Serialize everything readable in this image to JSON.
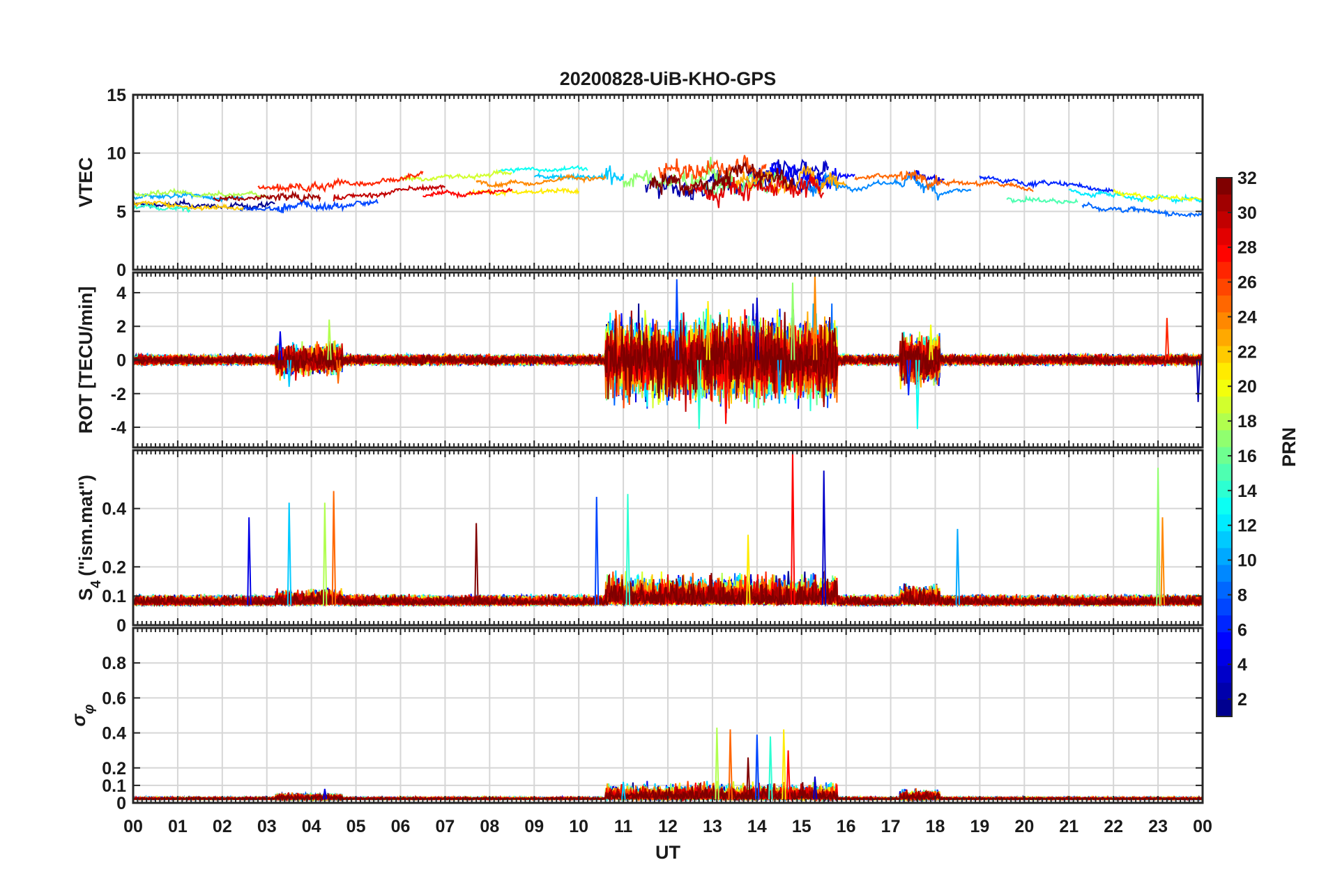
{
  "chart_data": {
    "type": "line",
    "title": "20200828-UiB-KHO-GPS",
    "xlabel": "UT",
    "x_range_hours": [
      0,
      24
    ],
    "x_tick_labels": [
      "00",
      "01",
      "02",
      "03",
      "04",
      "05",
      "06",
      "07",
      "08",
      "09",
      "10",
      "11",
      "12",
      "13",
      "14",
      "15",
      "16",
      "17",
      "18",
      "19",
      "20",
      "21",
      "22",
      "23",
      "00"
    ],
    "grid": true,
    "colorbar": {
      "label": "PRN",
      "range": [
        1,
        32
      ],
      "tick_labels": [
        "2",
        "4",
        "6",
        "8",
        "10",
        "12",
        "14",
        "16",
        "18",
        "20",
        "22",
        "24",
        "26",
        "28",
        "30",
        "32"
      ],
      "colormap": [
        "#00008f",
        "#0000ff",
        "#0080ff",
        "#00ffff",
        "#80ff80",
        "#ffff00",
        "#ff8000",
        "#ff0000",
        "#800000"
      ]
    },
    "panels": [
      {
        "name": "vtec",
        "ylabel": "VTEC",
        "ylim": [
          0,
          15
        ],
        "y_ticks": [
          0,
          5,
          10,
          15
        ],
        "y_tick_labels": [
          "0",
          "5",
          "10",
          "15"
        ],
        "baseline": [
          [
            0,
            6.2
          ],
          [
            2,
            6.0
          ],
          [
            4,
            6.3
          ],
          [
            6,
            7.2
          ],
          [
            8,
            7.6
          ],
          [
            10,
            7.9
          ],
          [
            11,
            7.6
          ],
          [
            12,
            7.3
          ],
          [
            13,
            7.8
          ],
          [
            14,
            8.2
          ],
          [
            15,
            7.8
          ],
          [
            16,
            7.4
          ],
          [
            17,
            7.8
          ],
          [
            18,
            7.4
          ],
          [
            19,
            7.0
          ],
          [
            20,
            6.6
          ],
          [
            21,
            6.2
          ],
          [
            22,
            5.8
          ],
          [
            23,
            5.4
          ],
          [
            24,
            5.3
          ]
        ],
        "noise": 0.35,
        "noise_active": 1.2,
        "series": [
          {
            "prn": 1,
            "start": 0,
            "end": 3.2
          },
          {
            "prn": 2,
            "start": 11.5,
            "end": 15.6
          },
          {
            "prn": 3,
            "start": 13.8,
            "end": 15.6
          },
          {
            "prn": 4,
            "start": 17.4,
            "end": 18.2
          },
          {
            "prn": 5,
            "start": 14.3,
            "end": 16.2
          },
          {
            "prn": 6,
            "start": 19.0,
            "end": 22.0
          },
          {
            "prn": 7,
            "start": 2.4,
            "end": 5.5
          },
          {
            "prn": 8,
            "start": 21.3,
            "end": 24
          },
          {
            "prn": 9,
            "start": 15.0,
            "end": 18.8
          },
          {
            "prn": 10,
            "start": 0,
            "end": 2.5
          },
          {
            "prn": 11,
            "start": 9.0,
            "end": 11.0
          },
          {
            "prn": 12,
            "start": 21.0,
            "end": 24
          },
          {
            "prn": 13,
            "start": 8.2,
            "end": 10.2
          },
          {
            "prn": 14,
            "start": 0,
            "end": 1.3
          },
          {
            "prn": 15,
            "start": 19.6,
            "end": 21.2
          },
          {
            "prn": 16,
            "start": 12.8,
            "end": 14.6
          },
          {
            "prn": 17,
            "start": 11.0,
            "end": 13.5
          },
          {
            "prn": 18,
            "start": 0,
            "end": 3.0
          },
          {
            "prn": 19,
            "start": 6.0,
            "end": 8.5
          },
          {
            "prn": 20,
            "start": 22.0,
            "end": 24
          },
          {
            "prn": 21,
            "start": 7.5,
            "end": 10.0
          },
          {
            "prn": 22,
            "start": 0,
            "end": 2.5
          },
          {
            "prn": 23,
            "start": 13.5,
            "end": 16.0
          },
          {
            "prn": 24,
            "start": 7.7,
            "end": 10.6
          },
          {
            "prn": 25,
            "start": 16.2,
            "end": 20.2
          },
          {
            "prn": 26,
            "start": 11.8,
            "end": 14.2
          },
          {
            "prn": 27,
            "start": 2.8,
            "end": 6.5
          },
          {
            "prn": 28,
            "start": 6.5,
            "end": 8.5
          },
          {
            "prn": 29,
            "start": 12.5,
            "end": 15.5
          },
          {
            "prn": 30,
            "start": 4.5,
            "end": 7.0
          },
          {
            "prn": 31,
            "start": 1.8,
            "end": 4.2
          },
          {
            "prn": 32,
            "start": 11.6,
            "end": 14.8
          }
        ]
      },
      {
        "name": "rot",
        "ylabel": "ROT [TECU/min]",
        "ylim": [
          -5.2,
          5.2
        ],
        "y_ticks": [
          -4,
          -2,
          0,
          2,
          4
        ],
        "y_tick_labels": [
          "-4",
          "-2",
          "0",
          "2",
          "4"
        ],
        "baseline": [
          [
            0,
            0
          ],
          [
            24,
            0
          ]
        ],
        "noise": 0.22,
        "noise_active": 1.3,
        "spikes": [
          {
            "x": 3.3,
            "y": 1.7
          },
          {
            "x": 3.5,
            "y": -1.6
          },
          {
            "x": 4.4,
            "y": 2.4
          },
          {
            "x": 4.6,
            "y": -1.4
          },
          {
            "x": 11.8,
            "y": -2.3
          },
          {
            "x": 12.2,
            "y": 4.8
          },
          {
            "x": 12.7,
            "y": -4.1
          },
          {
            "x": 12.9,
            "y": 3.5
          },
          {
            "x": 13.3,
            "y": -3.8
          },
          {
            "x": 14.0,
            "y": 3.7
          },
          {
            "x": 14.5,
            "y": -2.6
          },
          {
            "x": 14.8,
            "y": 4.6
          },
          {
            "x": 15.3,
            "y": 5.1
          },
          {
            "x": 15.5,
            "y": -2.8
          },
          {
            "x": 17.4,
            "y": -2.1
          },
          {
            "x": 17.6,
            "y": -4.1
          },
          {
            "x": 17.9,
            "y": 2.1
          },
          {
            "x": 23.2,
            "y": 2.5
          },
          {
            "x": 23.9,
            "y": -2.5
          }
        ]
      },
      {
        "name": "s4",
        "ylabel": "S",
        "ylabel_sub": "4",
        "ylabel_rest": "(\"ism.mat\")",
        "ylim": [
          0,
          0.6
        ],
        "y_ticks": [
          0,
          0.1,
          0.2,
          0.4
        ],
        "y_tick_labels": [
          "0",
          "0.1",
          "0.2",
          "0.4"
        ],
        "baseline": [
          [
            0,
            0.07
          ],
          [
            24,
            0.07
          ]
        ],
        "noise": 0.022,
        "noise_active": 0.035,
        "spikes": [
          {
            "x": 2.6,
            "y": 0.37
          },
          {
            "x": 3.5,
            "y": 0.42
          },
          {
            "x": 4.3,
            "y": 0.42
          },
          {
            "x": 4.5,
            "y": 0.46
          },
          {
            "x": 7.7,
            "y": 0.35
          },
          {
            "x": 10.4,
            "y": 0.44
          },
          {
            "x": 11.1,
            "y": 0.45
          },
          {
            "x": 13.8,
            "y": 0.31
          },
          {
            "x": 14.8,
            "y": 0.6
          },
          {
            "x": 15.5,
            "y": 0.53
          },
          {
            "x": 18.5,
            "y": 0.33
          },
          {
            "x": 23.0,
            "y": 0.54
          },
          {
            "x": 23.1,
            "y": 0.37
          }
        ]
      },
      {
        "name": "sigma_phi",
        "ylabel": "σ",
        "ylabel_sub": "φ",
        "ylim": [
          0,
          1
        ],
        "y_ticks": [
          0,
          0.1,
          0.2,
          0.4,
          0.6,
          0.8
        ],
        "y_tick_labels": [
          "0",
          "0.1",
          "0.2",
          "0.4",
          "0.6",
          "0.8"
        ],
        "baseline": [
          [
            0,
            0.02
          ],
          [
            24,
            0.02
          ]
        ],
        "noise": 0.008,
        "noise_active": 0.04,
        "spikes": [
          {
            "x": 4.3,
            "y": 0.08
          },
          {
            "x": 11.0,
            "y": 0.12
          },
          {
            "x": 13.1,
            "y": 0.43
          },
          {
            "x": 13.4,
            "y": 0.42
          },
          {
            "x": 13.8,
            "y": 0.26
          },
          {
            "x": 14.0,
            "y": 0.39
          },
          {
            "x": 14.3,
            "y": 0.38
          },
          {
            "x": 14.6,
            "y": 0.42
          },
          {
            "x": 14.7,
            "y": 0.3
          },
          {
            "x": 15.3,
            "y": 0.15
          }
        ]
      }
    ]
  }
}
